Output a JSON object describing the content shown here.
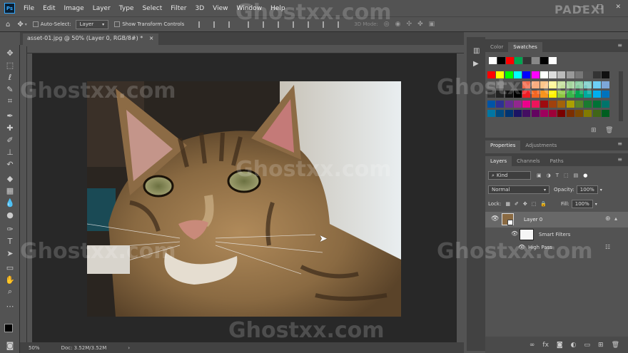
{
  "app": {
    "logo": "Ps",
    "brand": "PADEXI",
    "watermark": "Ghostxx.com"
  },
  "menu": [
    "File",
    "Edit",
    "Image",
    "Layer",
    "Type",
    "Select",
    "Filter",
    "3D",
    "View",
    "Window",
    "Help"
  ],
  "window_controls": {
    "min": "—",
    "max": "□",
    "close": "✕"
  },
  "options": {
    "auto_select": "Auto-Select:",
    "layer_select": "Layer",
    "transform": "Show Transform Controls",
    "mode_3d": "3D Mode:"
  },
  "document": {
    "tab_title": "asset-01.jpg @ 50% (Layer 0, RGB/8#) *",
    "tab_close": "×"
  },
  "status": {
    "zoom": "50%",
    "doc": "Doc: 3.52M/3.52M",
    "arrow": "›"
  },
  "color_panel": {
    "tabs": [
      "Color",
      "Swatches"
    ],
    "active": "Swatches"
  },
  "props_panel": {
    "tabs": [
      "Properties",
      "Adjustments"
    ],
    "active": "Properties"
  },
  "layers_panel": {
    "tabs": [
      "Layers",
      "Channels",
      "Paths"
    ],
    "active": "Layers",
    "filter_kind": "Kind",
    "blend_mode": "Normal",
    "opacity_label": "Opacity:",
    "opacity": "100%",
    "lock_label": "Lock:",
    "fill_label": "Fill:",
    "fill": "100%",
    "layers": [
      {
        "name": "Layer 0"
      }
    ],
    "smart_filters": "Smart Filters",
    "filters": [
      "High Pass"
    ]
  },
  "swatch_colors": {
    "recent": [
      "#ffffff",
      "#000000",
      "#ff0000",
      "#00a651",
      "#333333",
      "#888888",
      "#000000",
      "#ffffff"
    ],
    "row1": [
      "#ff0000",
      "#ffff00",
      "#00ff00",
      "#00ffff",
      "#0000ff",
      "#ff00ff",
      "#ffffff",
      "#dddddd",
      "#bbbbbb",
      "#999999",
      "#777777",
      "#555555",
      "#333333",
      "#111111"
    ],
    "row2": [
      "#666666",
      "#777777",
      "#555555",
      "#444444",
      "#f26c4f",
      "#f9ad81",
      "#fdc68a",
      "#fff79a",
      "#c4df9b",
      "#a3d39c",
      "#82ca9c",
      "#7accc8",
      "#6dcff6",
      "#7da7d9"
    ],
    "row3": [
      "#333333",
      "#222222",
      "#111111",
      "#000000",
      "#ed1c24",
      "#f26522",
      "#f7941d",
      "#fff200",
      "#8dc63f",
      "#39b54a",
      "#00a651",
      "#00a99d",
      "#00aeef",
      "#0072bc"
    ],
    "row4": [
      "#0054a6",
      "#2e3192",
      "#662d91",
      "#92278f",
      "#ec008c",
      "#ed145b",
      "#9e0b0f",
      "#a0410d",
      "#a3620a",
      "#aba000",
      "#598527",
      "#197b30",
      "#007236",
      "#00746b"
    ],
    "row5": [
      "#0076a3",
      "#004a80",
      "#003471",
      "#1b1464",
      "#440e62",
      "#630460",
      "#9e005d",
      "#9e0039",
      "#790000",
      "#7b2e00",
      "#7d4900",
      "#827b00",
      "#406618",
      "#005e20"
    ]
  }
}
